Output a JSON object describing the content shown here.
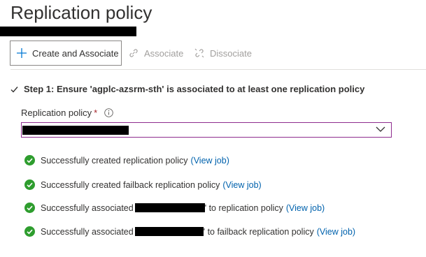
{
  "page": {
    "title": "Replication policy"
  },
  "toolbar": {
    "create_label": "Create and Associate",
    "associate_label": "Associate",
    "dissociate_label": "Dissociate"
  },
  "step": {
    "text": "Step 1: Ensure 'agplc-azsrm-sth' is associated to at least one replication policy"
  },
  "field": {
    "label": "Replication policy",
    "required_mark": "*"
  },
  "messages": [
    {
      "text": "Successfully created replication policy",
      "link": "(View job)"
    },
    {
      "text": "Successfully created failback replication policy",
      "link": "(View job)"
    },
    {
      "prefix": "Successfully associated",
      "suffix": "' to replication policy",
      "link": "(View job)"
    },
    {
      "prefix": "Successfully associated",
      "suffix": "' to failback replication policy",
      "link": "(View job)"
    }
  ],
  "colors": {
    "success": "#2e9d2e",
    "link": "#0062ad",
    "accent": "#8e2c8e",
    "required": "#a4262c"
  },
  "icons": [
    "plus-icon",
    "link-icon",
    "unlink-icon",
    "checkmark-icon",
    "info-icon",
    "chevron-down-icon",
    "success-icon"
  ]
}
